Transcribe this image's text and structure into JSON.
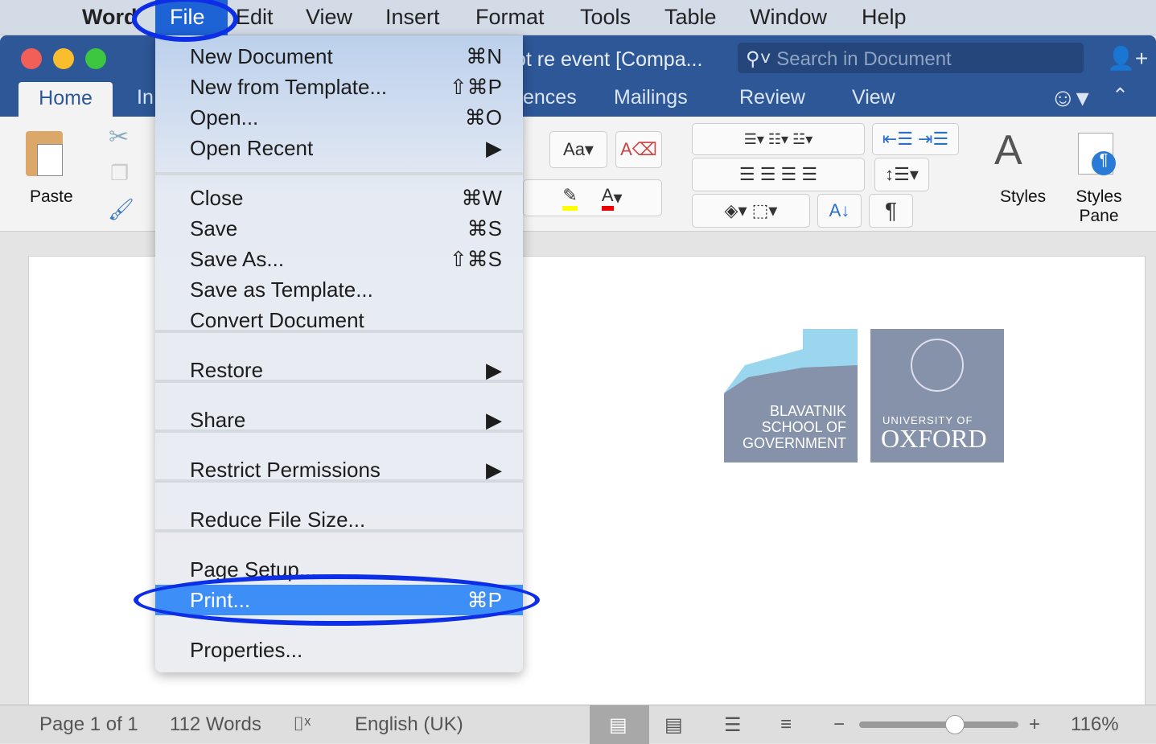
{
  "menubar": {
    "items": [
      "Word",
      "File",
      "Edit",
      "View",
      "Insert",
      "Format",
      "Tools",
      "Table",
      "Window",
      "Help"
    ]
  },
  "window": {
    "title": "ot re event [Compa...",
    "search_placeholder": "Search in Document"
  },
  "ribbon_tabs": [
    "Home",
    "In",
    "ences",
    "Mailings",
    "Review",
    "View"
  ],
  "ribbon": {
    "paste": "Paste",
    "styles": "Styles",
    "styles_pane": "Styles Pane"
  },
  "file_menu": {
    "items": [
      {
        "label": "New Document",
        "shortcut": "⌘N"
      },
      {
        "label": "New from Template...",
        "shortcut": "⇧⌘P"
      },
      {
        "label": "Open...",
        "shortcut": "⌘O"
      },
      {
        "label": "Open Recent",
        "shortcut": "▶"
      },
      {
        "label": "Close",
        "shortcut": "⌘W"
      },
      {
        "label": "Save",
        "shortcut": "⌘S"
      },
      {
        "label": "Save As...",
        "shortcut": "⇧⌘S"
      },
      {
        "label": "Save as Template...",
        "shortcut": ""
      },
      {
        "label": "Convert Document",
        "shortcut": ""
      },
      {
        "label": "Restore",
        "shortcut": "▶"
      },
      {
        "label": "Share",
        "shortcut": "▶"
      },
      {
        "label": "Restrict Permissions",
        "shortcut": "▶"
      },
      {
        "label": "Reduce File Size...",
        "shortcut": ""
      },
      {
        "label": "Page Setup...",
        "shortcut": ""
      },
      {
        "label": "Print...",
        "shortcut": "⌘P",
        "highlighted": true
      },
      {
        "label": "Properties...",
        "shortcut": ""
      }
    ]
  },
  "logo": {
    "blavatnik": [
      "BLAVATNIK",
      "SCHOOL OF",
      "GOVERNMENT"
    ],
    "oxford_small": "UNIVERSITY OF",
    "oxford_big": "OXFORD"
  },
  "status": {
    "page": "Page 1 of 1",
    "words": "112 Words",
    "language": "English (UK)",
    "zoom": "116%",
    "zoom_slider_fraction": 0.6
  },
  "colors": {
    "title_bar": "#2d5797",
    "highlight": "#3e8ef7",
    "annotation": "#0b2ee6"
  }
}
